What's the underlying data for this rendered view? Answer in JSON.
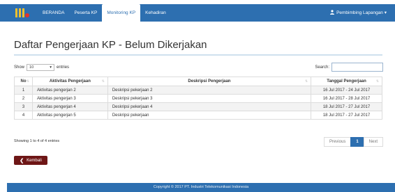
{
  "nav": {
    "items": [
      "BERANDA",
      "Peserta KP",
      "Monitoring KP",
      "Kehadiran"
    ],
    "active_index": 2,
    "user_label": "Pembimbing Lapangan ▾",
    "user_icon": "user-icon",
    "brand_icon": "company-logo"
  },
  "page": {
    "title": "Daftar Pengerjaan KP - Belum Dikerjakan"
  },
  "controls": {
    "show_label": "Show",
    "show_value": "10",
    "entries_label": "entries",
    "search_label": "Search:",
    "search_value": ""
  },
  "table": {
    "headers": [
      "No",
      "Aktivitas Pengerjaan",
      "Deskripsi Pengerjaan",
      "Tanggal Pengerjaan"
    ],
    "rows": [
      [
        "1",
        "Aktivitas pengerjan 2",
        "Deskripsi pekerjaan 2",
        "16 Jul 2017 - 24 Jul 2017"
      ],
      [
        "2",
        "Aktivitas pengerjan 3",
        "Deskripsi pekerjaan 3",
        "16 Jul 2017 - 28 Jul 2017"
      ],
      [
        "3",
        "Aktivitas pengerjan 4",
        "Deskripsi pekerjaan 4",
        "18 Jul 2017 - 27 Jul 2017"
      ],
      [
        "4",
        "Aktivitas pengerjan 5",
        "Deskripsi pekerjaan",
        "18 Jul 2017 - 27 Jul 2017"
      ]
    ]
  },
  "pagination": {
    "info": "Showing 1 to 4 of 4 entries",
    "previous": "Previous",
    "current": "1",
    "next": "Next"
  },
  "actions": {
    "back_label": "Kembali"
  },
  "footer": {
    "text": "Copyright © 2017 PT. Industri Telekomunikasi Indonesia"
  },
  "colors": {
    "primary": "#2d6fb0",
    "back_button": "#6e1616"
  }
}
